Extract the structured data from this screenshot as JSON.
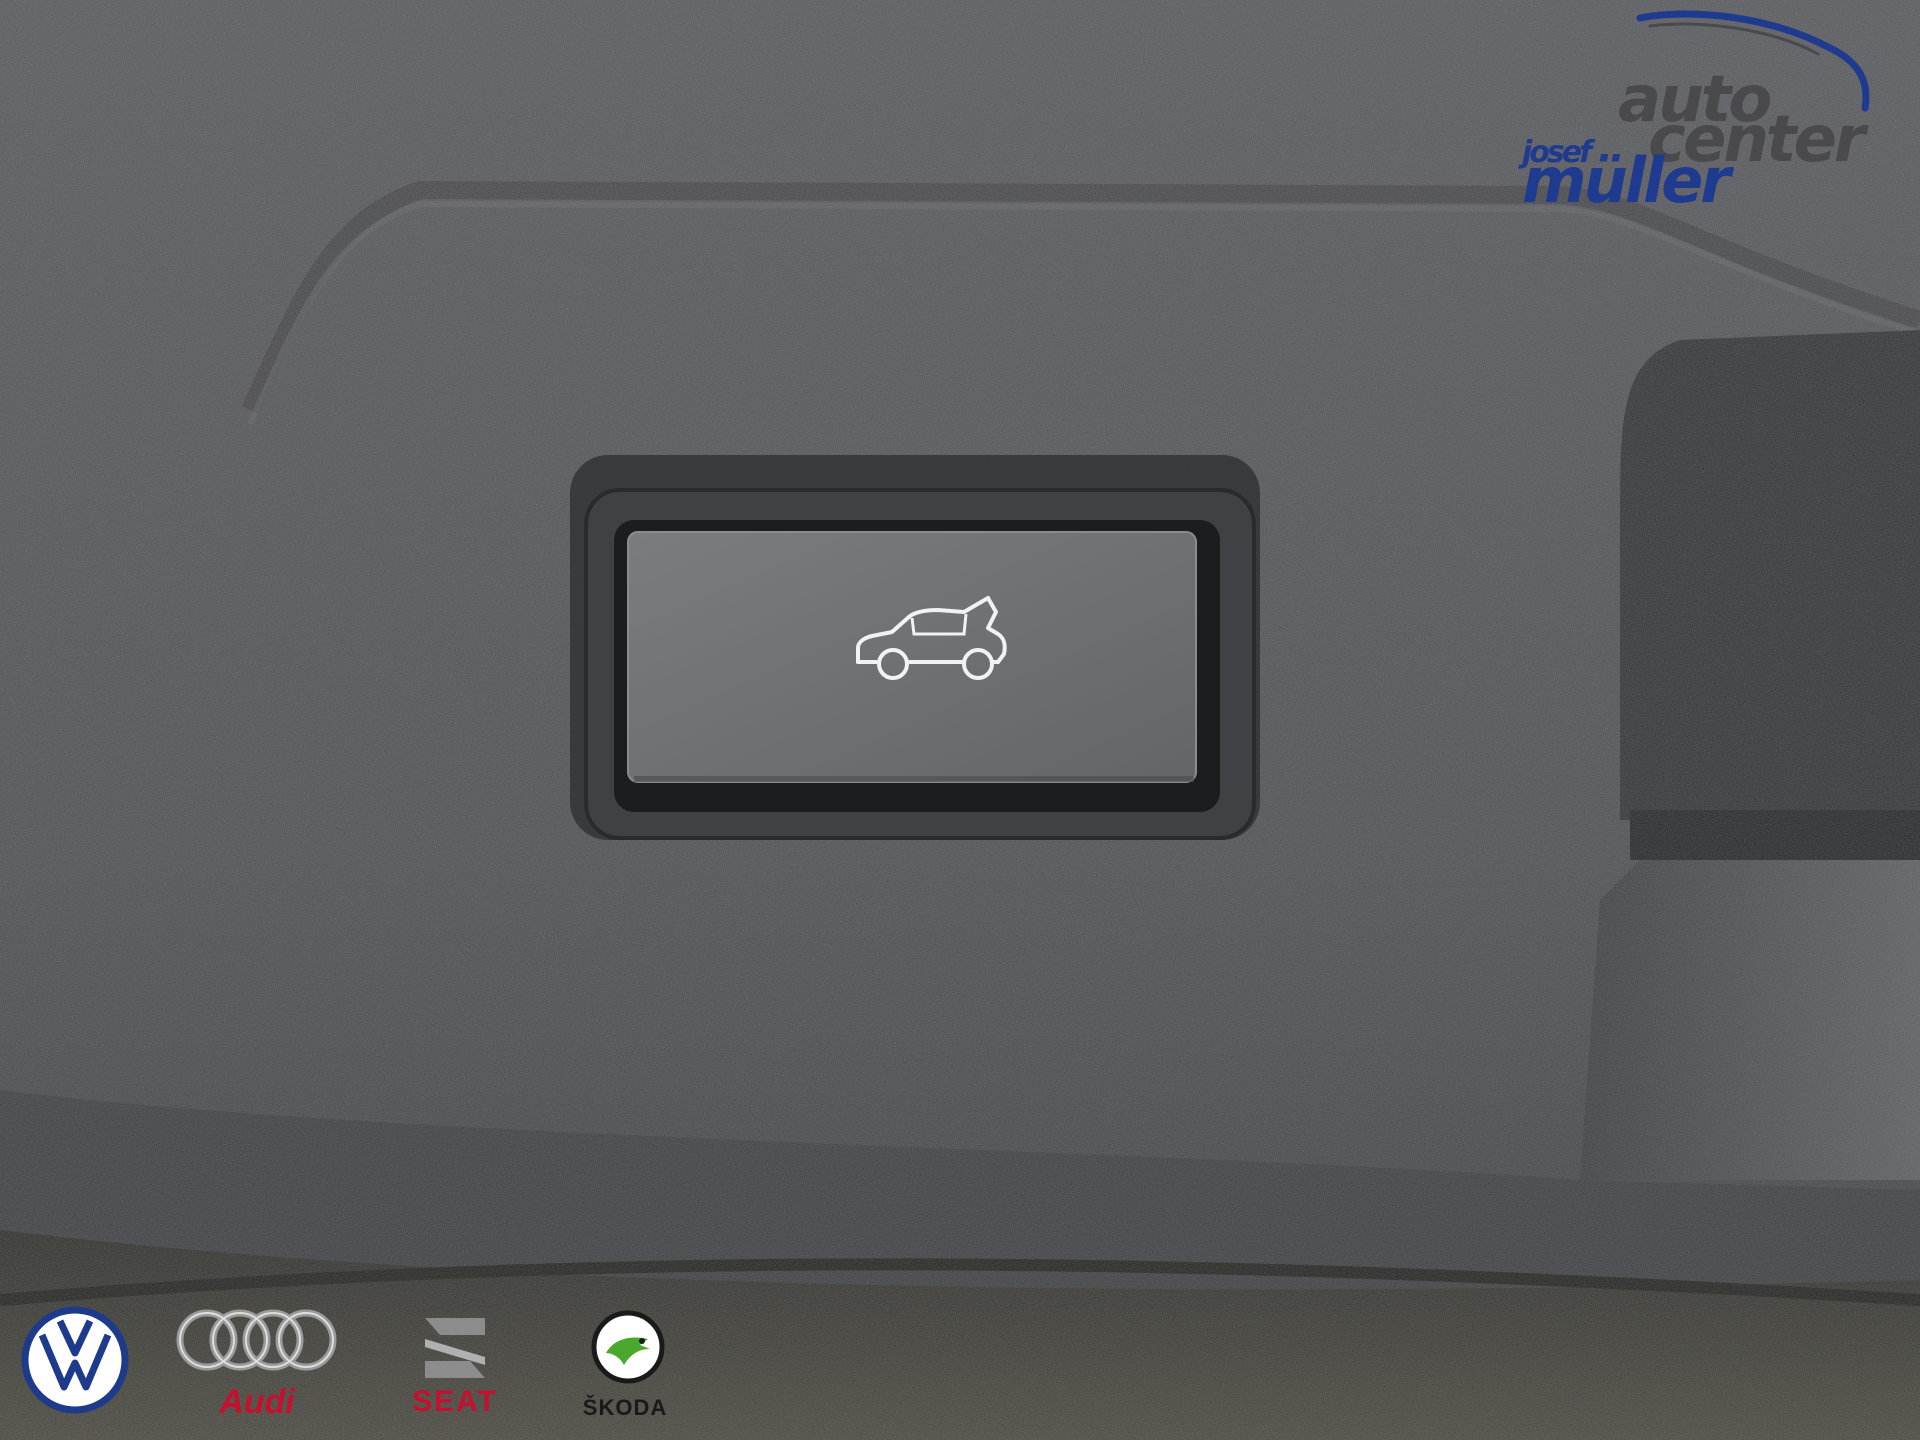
{
  "dealer": {
    "word1": "auto",
    "word2": "center",
    "word3": "josef",
    "word4": "müller",
    "brand_blue": "#1f3b8f",
    "brand_grey": "#4a4a4d"
  },
  "brands": {
    "audi": "Audi",
    "seat": "SEAT",
    "skoda": "ŠKODA"
  },
  "button": {
    "icon": "tailgate-open-icon",
    "function": "trunk"
  },
  "colors": {
    "trim": "#4a4b4d",
    "button_face": "#6e7072",
    "bezel": "#3d3e40",
    "vw_blue": "#1e3a8a",
    "audi_red": "#c8102e",
    "skoda_green": "#4ba82e"
  }
}
